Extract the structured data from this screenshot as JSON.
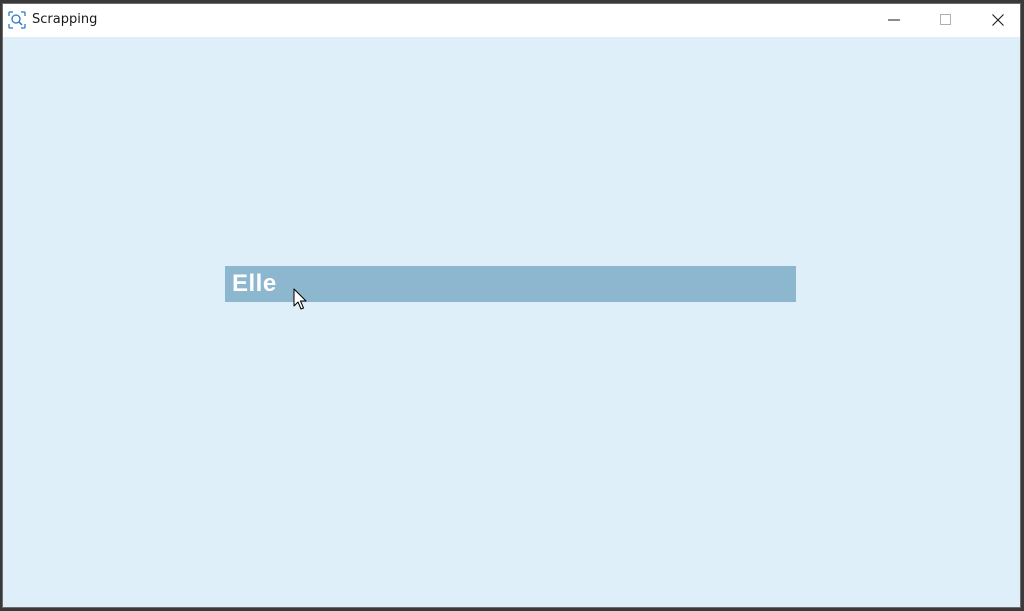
{
  "window": {
    "title": "Scrapping",
    "icon": "scan-search-icon",
    "controls": [
      "minimize-icon",
      "maximize-icon",
      "close-icon"
    ]
  },
  "main": {
    "banner_text": "Elle"
  },
  "colors": {
    "background": "#dfeffa",
    "banner": "#8db6cf",
    "banner_text": "#ffffff",
    "titlebar": "#ffffff"
  }
}
